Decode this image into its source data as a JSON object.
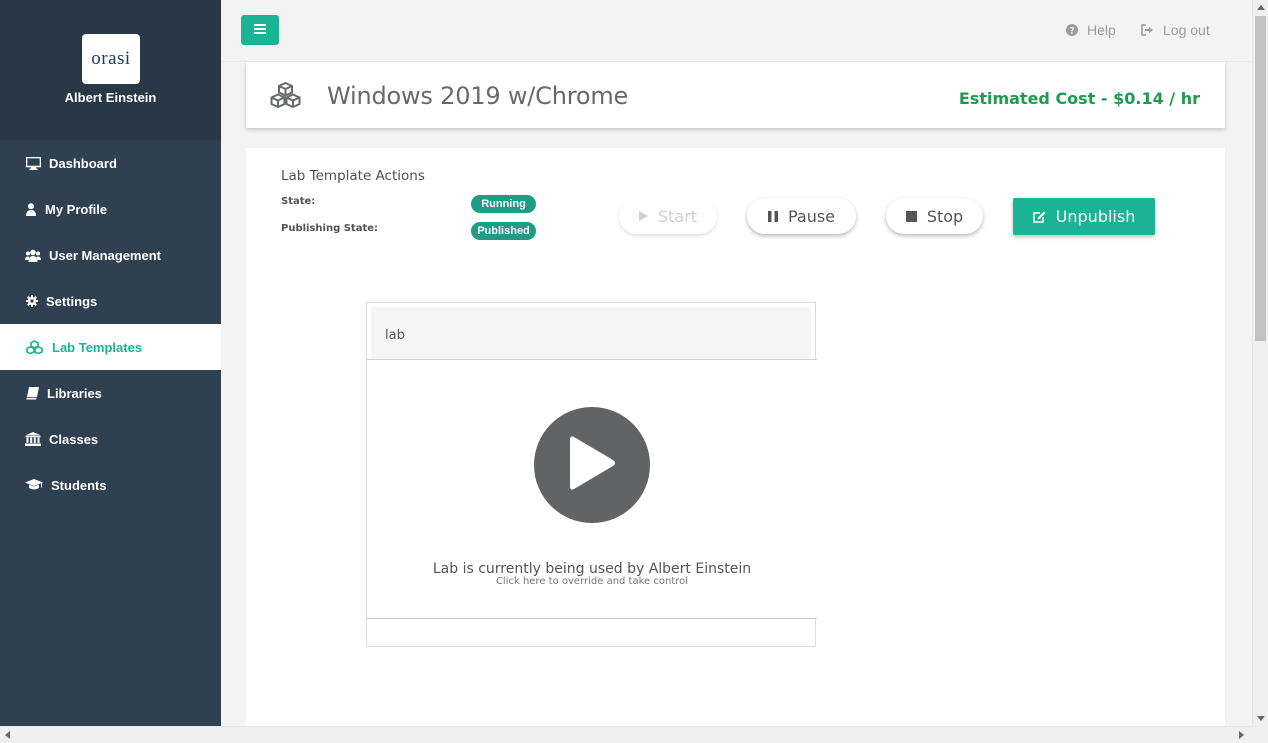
{
  "sidebar": {
    "logo_text": "orasi",
    "user_name": "Albert Einstein",
    "items": [
      {
        "label": "Dashboard",
        "icon": "monitor-icon"
      },
      {
        "label": "My Profile",
        "icon": "user-icon"
      },
      {
        "label": "User Management",
        "icon": "users-icon"
      },
      {
        "label": "Settings",
        "icon": "gear-icon"
      },
      {
        "label": "Lab Templates",
        "icon": "cubes-icon",
        "active": true
      },
      {
        "label": "Libraries",
        "icon": "book-icon"
      },
      {
        "label": "Classes",
        "icon": "institution-icon"
      },
      {
        "label": "Students",
        "icon": "graduation-cap-icon"
      }
    ]
  },
  "topbar": {
    "help_label": "Help",
    "logout_label": "Log out"
  },
  "header": {
    "title": "Windows 2019 w/Chrome",
    "cost_label": "Estimated Cost - $0.14 / hr"
  },
  "actions": {
    "section_title": "Lab Template Actions",
    "state_label": "State:",
    "state_value": "Running",
    "publishing_label": "Publishing State:",
    "publishing_value": "Published",
    "start_label": "Start",
    "pause_label": "Pause",
    "stop_label": "Stop",
    "unpublish_label": "Unpublish"
  },
  "lab": {
    "name": "lab",
    "message": "Lab is currently being used by Albert Einstein",
    "sub_message": "Click here to override and take control"
  },
  "colors": {
    "accent": "#1ab394",
    "sidebar_bg": "#2f4050",
    "cost_green": "#1f9a4e",
    "pill_green": "#1c9e84",
    "play_gray": "#626365"
  }
}
